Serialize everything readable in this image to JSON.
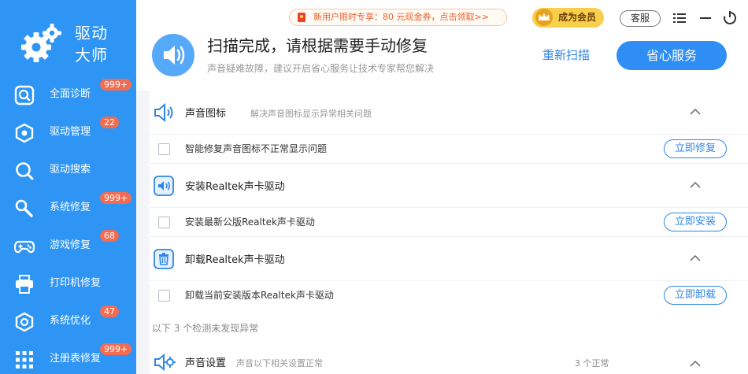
{
  "app": {
    "name": "驱动大师"
  },
  "sidebar": {
    "items": [
      {
        "label": "全面诊断",
        "badge": "999+",
        "icon": "search-icon"
      },
      {
        "label": "驱动管理",
        "badge": "22",
        "icon": "hexagon-icon"
      },
      {
        "label": "驱动搜索",
        "badge": "",
        "icon": "magnifier-icon"
      },
      {
        "label": "系统修复",
        "badge": "999+",
        "icon": "wrench-icon"
      },
      {
        "label": "游戏修复",
        "badge": "68",
        "icon": "gamepad-icon"
      },
      {
        "label": "打印机修复",
        "badge": "",
        "icon": "printer-icon"
      },
      {
        "label": "系统优化",
        "badge": "47",
        "icon": "optimize-icon"
      },
      {
        "label": "注册表修复",
        "badge": "999+",
        "icon": "grid-icon"
      }
    ]
  },
  "topbar": {
    "promo": "新用户限时专享：80 元现金券，点击领取>>",
    "vip": "成为会员",
    "service": "客服"
  },
  "header": {
    "title": "扫描完成，请根据需要手动修复",
    "subtitle": "声音疑难故障，建议开启省心服务让技术专家帮您解决",
    "rescan": "重新扫描",
    "primary": "省心服务"
  },
  "sections": [
    {
      "title": "声音图标",
      "desc": "解决声音图标显示异常相关问题",
      "icon": "speaker-icon",
      "row": {
        "label": "智能修复声音图标不正常显示问题",
        "action": "立即修复"
      }
    },
    {
      "title": "安装Realtek声卡驱动",
      "desc": "",
      "icon": "audio-driver-icon",
      "row": {
        "label": "安装最新公版Realtek声卡驱动",
        "action": "立即安装"
      }
    },
    {
      "title": "卸载Realtek声卡驱动",
      "desc": "",
      "icon": "trash-icon",
      "row": {
        "label": "卸载当前安装版本Realtek声卡驱动",
        "action": "立即卸载"
      }
    }
  ],
  "normal_divider": "以下 3 个检测未发现异常",
  "normal_section": {
    "title": "声音设置",
    "desc": "声音以下相关设置正常",
    "count": "3 个正常",
    "icon": "speaker-settings-icon"
  },
  "colors": {
    "sidebar": "#2f95f4",
    "accent": "#2f86e8",
    "badge": "#f26c52",
    "vip": "#f8cf4b"
  }
}
